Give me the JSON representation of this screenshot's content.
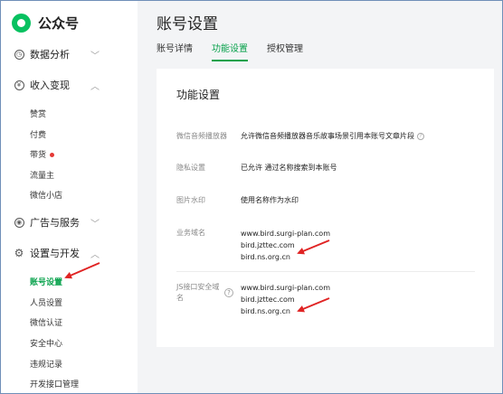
{
  "brand": {
    "name": "公众号"
  },
  "sidebar": {
    "groups": [
      {
        "label": "数据分析",
        "icon": "clock-icon"
      },
      {
        "label": "收入变现",
        "icon": "income-icon"
      },
      {
        "label": "广告与服务",
        "icon": "compass-icon"
      },
      {
        "label": "设置与开发",
        "icon": "gear-icon"
      }
    ],
    "income_items": [
      "赞赏",
      "付费",
      "带货",
      "流量主",
      "微信小店"
    ],
    "settings_items": [
      "账号设置",
      "人员设置",
      "微信认证",
      "安全中心",
      "违规记录",
      "开发接口管理"
    ]
  },
  "header": {
    "title": "账号设置"
  },
  "tabs": [
    "账号详情",
    "功能设置",
    "授权管理"
  ],
  "panel": {
    "title": "功能设置",
    "player": {
      "label": "微信音频播放器",
      "value": "允许微信音频播放器音乐故事场景引用本账号文章片段"
    },
    "privacy": {
      "label": "隐私设置",
      "value": "已允许 通过名称搜索到本账号"
    },
    "watermark": {
      "label": "图片水印",
      "value": "使用名称作为水印"
    },
    "business_domain": {
      "label": "业务域名",
      "domains": [
        "www.bird.surgi-plan.com",
        "bird.jzttec.com",
        "bird.ns.org.cn"
      ]
    },
    "js_domain": {
      "label_line1": "JS接口安全域",
      "label_line2": "名",
      "domains": [
        "www.bird.surgi-plan.com",
        "bird.jzttec.com",
        "bird.ns.org.cn"
      ]
    }
  },
  "colors": {
    "accent": "#07a14b",
    "arrow": "#e02424",
    "badge": "#e53935"
  }
}
